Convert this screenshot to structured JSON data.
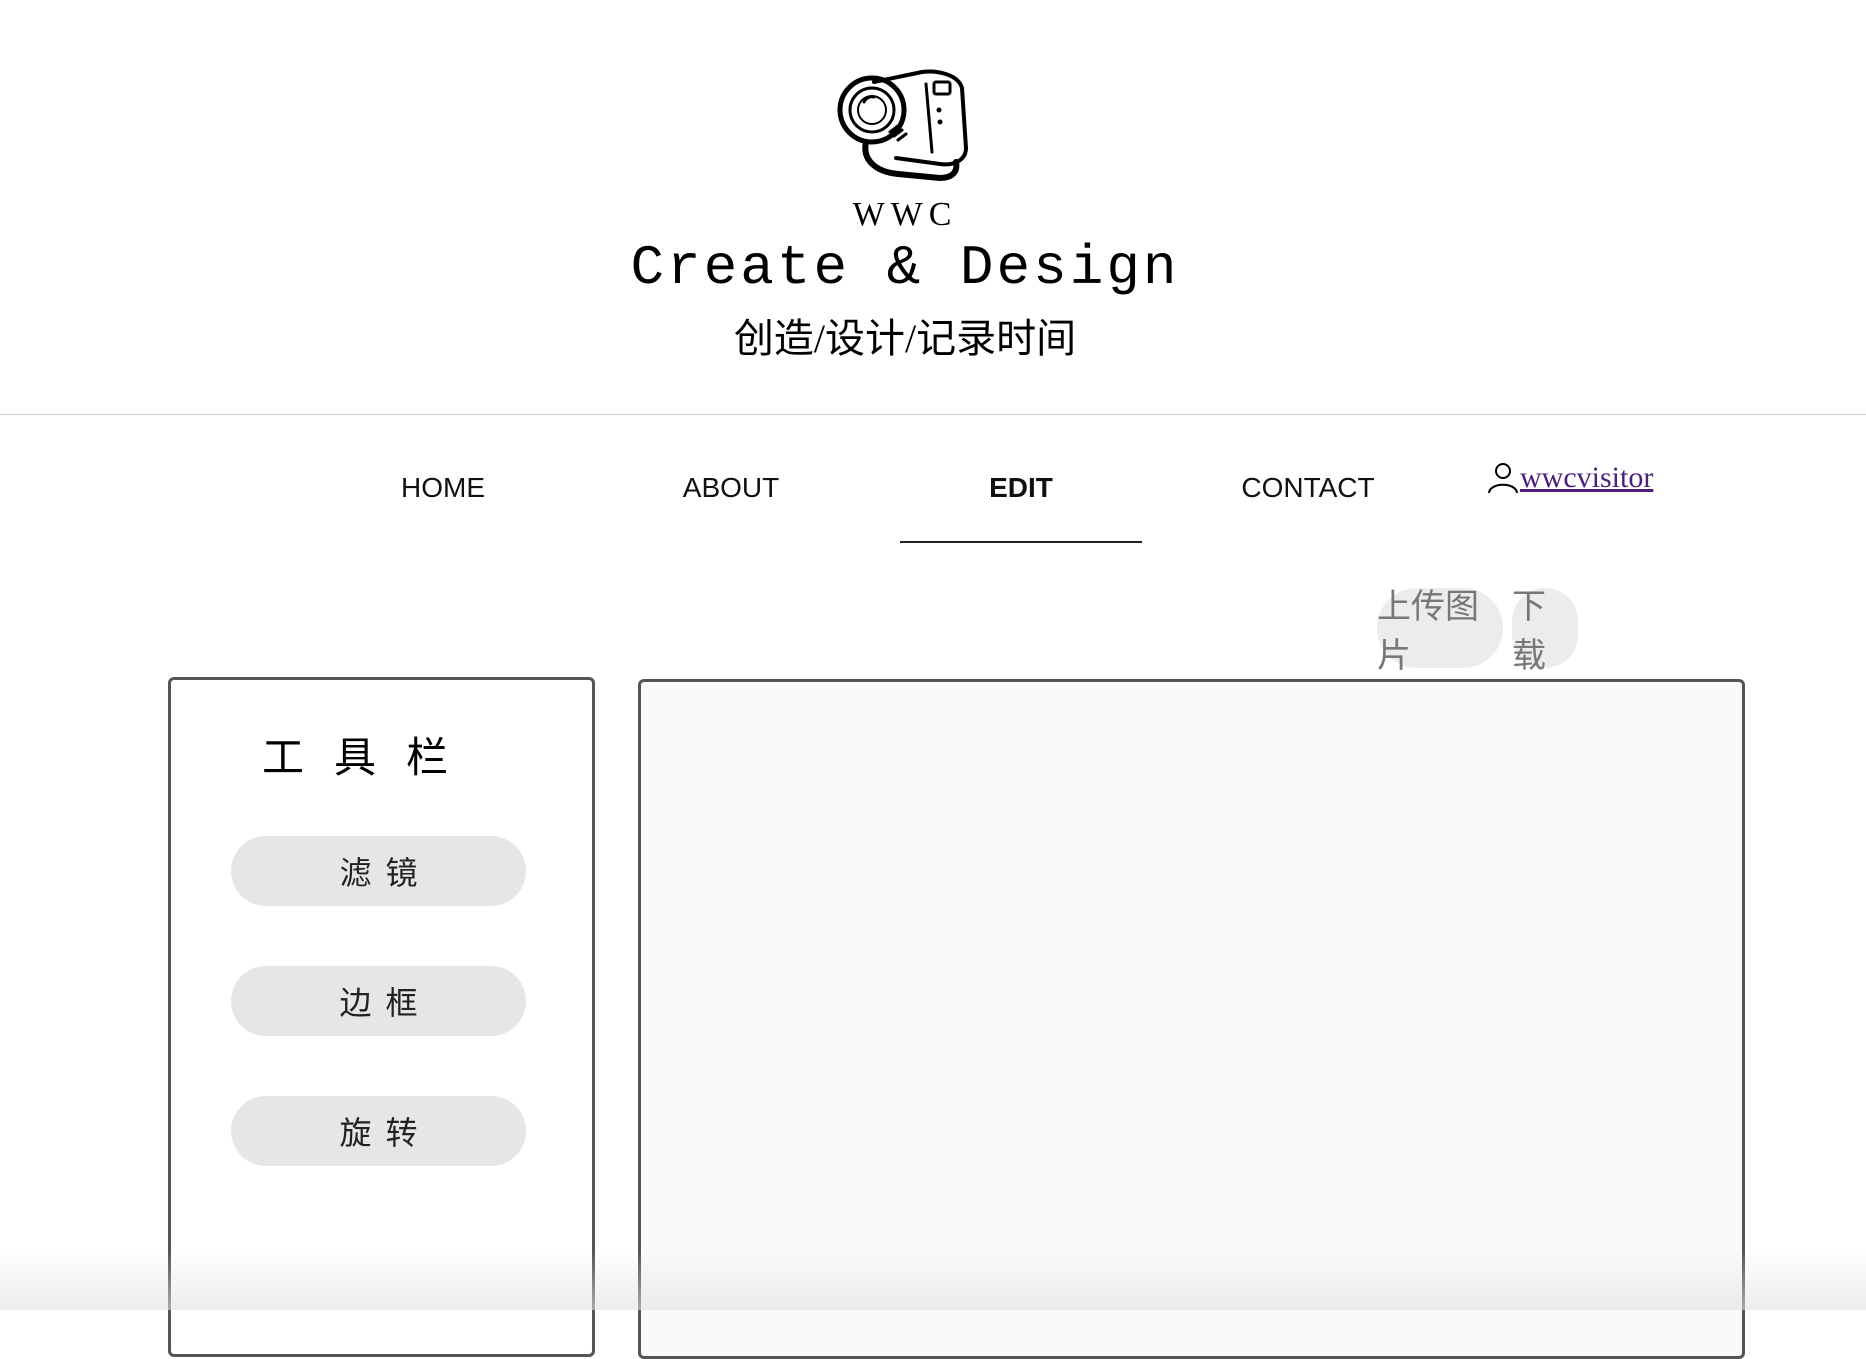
{
  "header": {
    "logo_icon": "camera-sketch-icon",
    "brand": "WWC",
    "tagline": "Create & Design",
    "subtitle": "创造/设计/记录时间"
  },
  "nav": {
    "items": [
      {
        "label": "HOME",
        "active": false
      },
      {
        "label": "ABOUT",
        "active": false
      },
      {
        "label": "EDIT",
        "active": true
      },
      {
        "label": "CONTACT",
        "active": false
      }
    ],
    "user_icon": "user-icon",
    "username": "wwcvisitor"
  },
  "actions": {
    "upload_label": "上传图片",
    "download_label": "下载"
  },
  "toolbar": {
    "title": "工具栏",
    "tools": [
      {
        "label": "滤镜"
      },
      {
        "label": "边框"
      },
      {
        "label": "旋转"
      }
    ]
  },
  "colors": {
    "link_visited": "#4b1f7a",
    "panel_border": "#555555",
    "button_bg": "#e6e6e6"
  }
}
